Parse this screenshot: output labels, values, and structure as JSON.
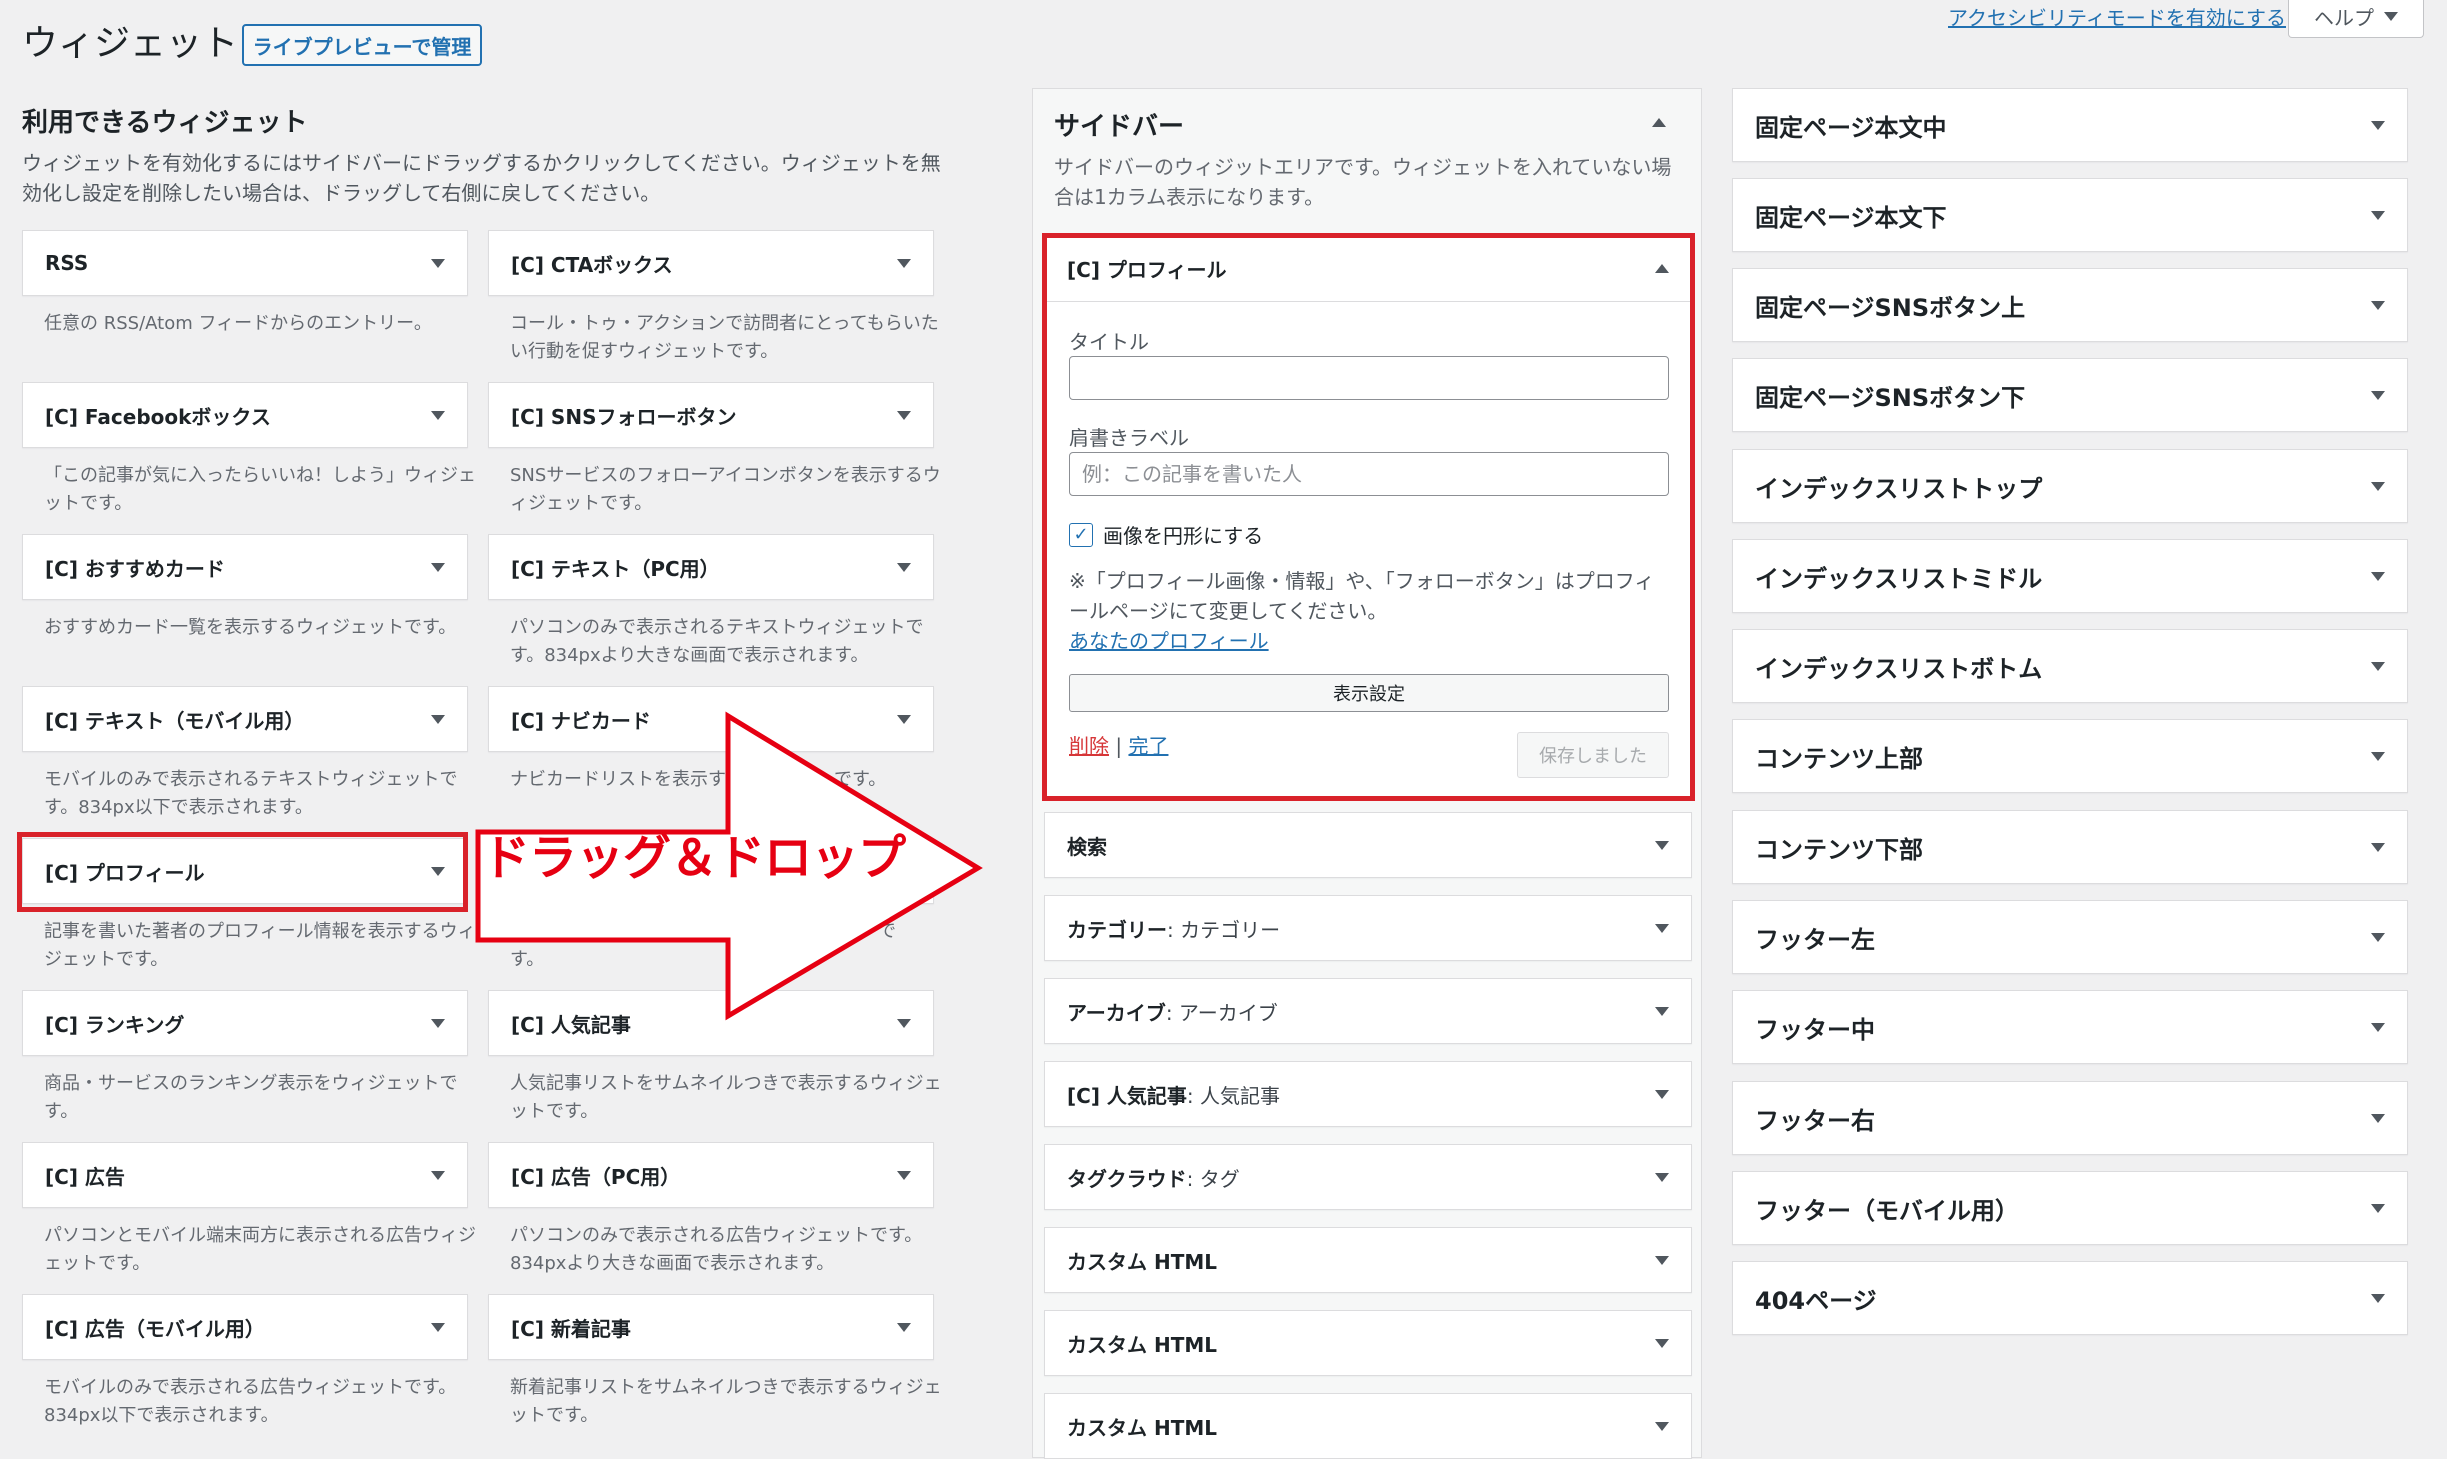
{
  "header": {
    "title": "ウィジェット",
    "live_preview": "ライブプレビューで管理",
    "accessibility_link": "アクセシビリティモードを有効にする",
    "help": "ヘルプ"
  },
  "available": {
    "heading": "利用できるウィジェット",
    "description": "ウィジェットを有効化するにはサイドバーにドラッグするかクリックしてください。ウィジェットを無効化し設定を削除したい場合は、ドラッグして右側に戻してください。",
    "widgets": [
      {
        "title": "RSS",
        "desc": "任意の RSS/Atom フィードからのエントリー。"
      },
      {
        "title": "[C] CTAボックス",
        "desc": "コール・トゥ・アクションで訪問者にとってもらいたい行動を促すウィジェットです。"
      },
      {
        "title": "[C] Facebookボックス",
        "desc": "「この記事が気に入ったらいいね！しよう」ウィジェットです。"
      },
      {
        "title": "[C] SNSフォローボタン",
        "desc": "SNSサービスのフォローアイコンボタンを表示するウィジェットです。"
      },
      {
        "title": "[C] おすすめカード",
        "desc": "おすすめカード一覧を表示するウィジェットです。"
      },
      {
        "title": "[C] テキスト（PC用）",
        "desc": "パソコンのみで表示されるテキストウィジェットです。834pxより大きな画面で表示されます。"
      },
      {
        "title": "[C] テキスト（モバイル用）",
        "desc": "モバイルのみで表示されるテキストウィジェットです。834px以下で表示されます。"
      },
      {
        "title": "[C] ナビカード",
        "desc": "ナビカードリストを表示す　　　　　　です。"
      },
      {
        "title": "[C] プロフィール",
        "desc": "記事を書いた著者のプロフィール情報を表示するウィジェットです。"
      },
      {
        "title": "",
        "desc": "す。"
      },
      {
        "title": "[C] ランキング",
        "desc": "商品・サービスのランキング表示をウィジェットです。"
      },
      {
        "title": "[C] 人気記事",
        "desc": "人気記事リストをサムネイルつきで表示するウィジェットです。"
      },
      {
        "title": "[C] 広告",
        "desc": "パソコンとモバイル端末両方に表示される広告ウィジェットです。"
      },
      {
        "title": "[C] 広告（PC用）",
        "desc": "パソコンのみで表示される広告ウィジェットです。834pxより大きな画面で表示されます。"
      },
      {
        "title": "[C] 広告（モバイル用）",
        "desc": "モバイルのみで表示される広告ウィジェットです。834px以下で表示されます。"
      },
      {
        "title": "[C] 新着記事",
        "desc": "新着記事リストをサムネイルつきで表示するウィジェットです。"
      }
    ],
    "overflow_text": "で"
  },
  "sidebar": {
    "title": "サイドバー",
    "description": "サイドバーのウィジットエリアです。ウィジェットを入れていない場合は1カラム表示になります。",
    "profile_widget": {
      "title": "[C] プロフィール",
      "title_label": "タイトル",
      "title_value": "",
      "caption_label": "肩書きラベル",
      "caption_placeholder": "例：この記事を書いた人",
      "checkbox_label": "画像を円形にする",
      "checkbox_checked": true,
      "note": "※「プロフィール画像・情報」や、「フォローボタン」はプロフィールページにて変更してください。",
      "profile_link": "あなたのプロフィール",
      "display_settings": "表示設定",
      "delete": "削除",
      "separator": "|",
      "done": "完了",
      "saved": "保存しました"
    },
    "widgets": [
      {
        "type": "検索",
        "sub": ""
      },
      {
        "type": "カテゴリー",
        "sub": ": カテゴリー"
      },
      {
        "type": "アーカイブ",
        "sub": ": アーカイブ"
      },
      {
        "type": "[C] 人気記事",
        "sub": ": 人気記事"
      },
      {
        "type": "タグクラウド",
        "sub": ": タグ"
      },
      {
        "type": "カスタム HTML",
        "sub": ""
      },
      {
        "type": "カスタム HTML",
        "sub": ""
      },
      {
        "type": "カスタム HTML",
        "sub": ""
      }
    ]
  },
  "widget_areas": [
    "固定ページ本文中",
    "固定ページ本文下",
    "固定ページSNSボタン上",
    "固定ページSNSボタン下",
    "インデックスリストトップ",
    "インデックスリストミドル",
    "インデックスリストボトム",
    "コンテンツ上部",
    "コンテンツ下部",
    "フッター左",
    "フッター中",
    "フッター右",
    "フッター（モバイル用）",
    "404ページ"
  ],
  "annotation": {
    "label": "ドラッグ＆ドロップ",
    "highlight_color": "#d9222a"
  }
}
